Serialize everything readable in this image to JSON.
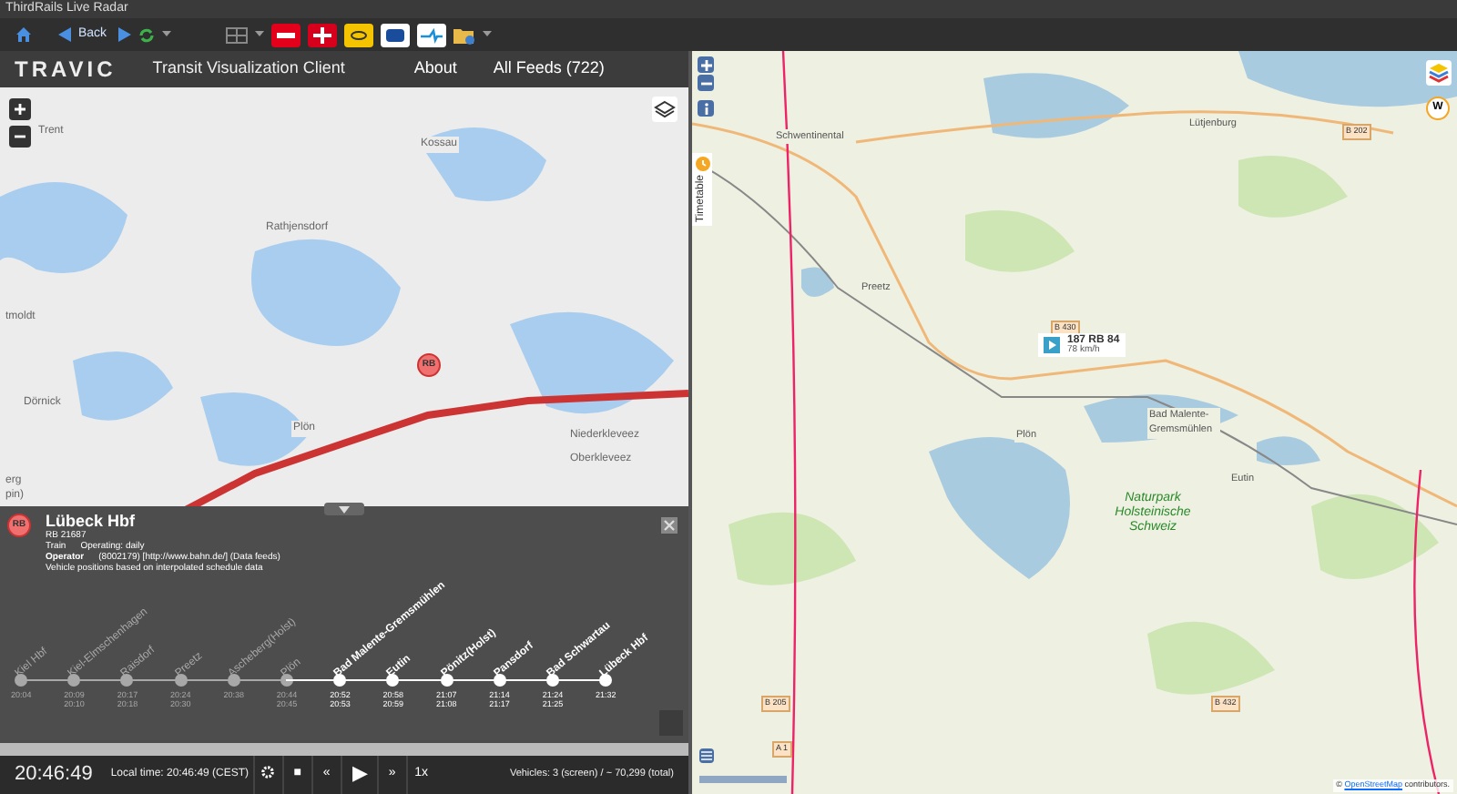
{
  "window": {
    "title": "ThirdRails Live Radar"
  },
  "toolbar": {
    "back_label": "Back"
  },
  "nav": {
    "brand": "TRAVIC",
    "subtitle": "Transit Visualization Client",
    "links": [
      {
        "label": "About"
      },
      {
        "label": "All Feeds (722)"
      }
    ]
  },
  "left_map": {
    "route_badge": "RB",
    "labels": [
      {
        "text": "Trent"
      },
      {
        "text": "Kossau"
      },
      {
        "text": "Rathjensdorf"
      },
      {
        "text": "tmoldt"
      },
      {
        "text": "Dörnick"
      },
      {
        "text": "Plön"
      },
      {
        "text": "Niederkleveez"
      },
      {
        "text": "Oberkleveez"
      },
      {
        "text": "erg"
      },
      {
        "text": "pin)"
      }
    ]
  },
  "info_panel": {
    "badge": "RB",
    "destination": "Lübeck Hbf",
    "trip": "RB 21687",
    "type": "Train",
    "schedule": "Operating: daily",
    "operator_label": "Operator",
    "operator": "(8002179) [http://www.bahn.de/] (Data feeds)",
    "note": "Vehicle positions based on interpolated schedule data",
    "stops": [
      {
        "name": "Kiel Hbf",
        "arrival": "20:04",
        "passed": true
      },
      {
        "name": "Kiel-Elmschenhagen",
        "arrival": "20:09",
        "departure": "20:10",
        "passed": true
      },
      {
        "name": "Raisdorf",
        "arrival": "20:17",
        "departure": "20:18",
        "passed": true
      },
      {
        "name": "Preetz",
        "arrival": "20:24",
        "departure": "20:30",
        "passed": true
      },
      {
        "name": "Ascheberg(Holst)",
        "arrival": "20:38",
        "passed": true
      },
      {
        "name": "Plön",
        "arrival": "20:44",
        "departure": "20:45",
        "passed": true
      },
      {
        "name": "Bad Malente-Gremsmühlen",
        "arrival": "20:52",
        "departure": "20:53",
        "passed": false
      },
      {
        "name": "Eutin",
        "arrival": "20:58",
        "departure": "20:59",
        "passed": false
      },
      {
        "name": "Pönitz(Holst)",
        "arrival": "21:07",
        "departure": "21:08",
        "passed": false
      },
      {
        "name": "Pansdorf",
        "arrival": "21:14",
        "departure": "21:17",
        "passed": false
      },
      {
        "name": "Bad Schwartau",
        "arrival": "21:24",
        "departure": "21:25",
        "passed": false
      },
      {
        "name": "Lübeck Hbf",
        "arrival": "21:32",
        "passed": false
      }
    ]
  },
  "controls": {
    "transport": [
      {
        "symbol": "■"
      },
      {
        "symbol": "«"
      },
      {
        "symbol": "▶"
      },
      {
        "symbol": "»"
      }
    ],
    "clock": "20:46:49",
    "local_time": "Local time: 20:46:49 (CEST)",
    "speed": "1x",
    "vehicles": "Vehicles: 3 (screen) / ~ 70,299 (total)"
  },
  "right_map": {
    "timetable_tab": "Timetable",
    "vehicle": {
      "line": "187 RB 84",
      "speed": "78 km/h"
    },
    "labels": [
      {
        "text": "Schwentinental",
        "kind": "place"
      },
      {
        "text": "Lütjenburg",
        "kind": "place"
      },
      {
        "text": "B 202",
        "kind": "road"
      },
      {
        "text": "Preetz",
        "kind": "place"
      },
      {
        "text": "B 430",
        "kind": "road"
      },
      {
        "text": "Plön",
        "kind": "place"
      },
      {
        "text": "Bad Malente-Gremsmühlen",
        "kind": "place"
      },
      {
        "text": "Eutin",
        "kind": "place"
      },
      {
        "text": "Naturpark Holsteinische Schweiz",
        "kind": "park"
      },
      {
        "text": "B 205",
        "kind": "road"
      },
      {
        "text": "B 432",
        "kind": "road"
      },
      {
        "text": "A 1",
        "kind": "road"
      }
    ],
    "weather_label": "W",
    "attribution_prefix": "©",
    "attribution_link": "OpenStreetMap",
    "attribution_suffix": "contributors."
  }
}
